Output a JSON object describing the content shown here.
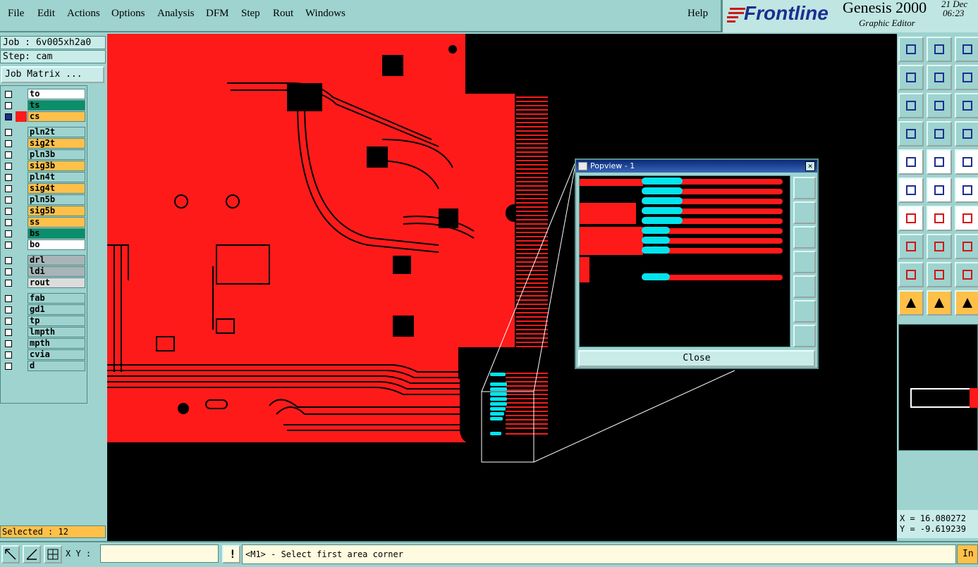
{
  "menu": {
    "items": [
      "File",
      "Edit",
      "Actions",
      "Options",
      "Analysis",
      "DFM",
      "Step",
      "Rout",
      "Windows"
    ],
    "help": "Help"
  },
  "brand": {
    "logo": "Frontline",
    "product": "Genesis 2000",
    "subtitle": "Graphic Editor",
    "date": "21 Dec",
    "time": "06:23"
  },
  "job": {
    "job_label": "Job : 6v005xh2a0",
    "step_label": "Step: cam",
    "matrix_button": "Job Matrix ..."
  },
  "layers": [
    {
      "name": "to",
      "color": "#ffffff"
    },
    {
      "name": "ts",
      "color": "#0a8f6a"
    },
    {
      "name": "cs",
      "color": "#ffc04a",
      "active": true
    },
    {
      "name": "pln2t",
      "color": "#9ed3cf"
    },
    {
      "name": "sig2t",
      "color": "#ffc04a"
    },
    {
      "name": "pln3b",
      "color": "#9ed3cf"
    },
    {
      "name": "sig3b",
      "color": "#ffc04a"
    },
    {
      "name": "pln4t",
      "color": "#9ed3cf"
    },
    {
      "name": "sig4t",
      "color": "#ffc04a"
    },
    {
      "name": "pln5b",
      "color": "#9ed3cf"
    },
    {
      "name": "sig5b",
      "color": "#ffc04a"
    },
    {
      "name": "ss",
      "color": "#ffc04a"
    },
    {
      "name": "bs",
      "color": "#0a8f6a"
    },
    {
      "name": "bo",
      "color": "#ffffff"
    },
    {
      "name": "drl",
      "color": "#a8b4b8"
    },
    {
      "name": "ldi",
      "color": "#a8b4b8"
    },
    {
      "name": "rout",
      "color": "#dcdcdc"
    },
    {
      "name": "fab",
      "color": "#9ed3cf"
    },
    {
      "name": "gd1",
      "color": "#9ed3cf"
    },
    {
      "name": "tp",
      "color": "#9ed3cf"
    },
    {
      "name": "lmpth",
      "color": "#9ed3cf"
    },
    {
      "name": "mpth",
      "color": "#9ed3cf"
    },
    {
      "name": "cvia",
      "color": "#9ed3cf"
    },
    {
      "name": "d",
      "color": "#9ed3cf"
    }
  ],
  "selected": "Selected : 12",
  "popview": {
    "title": "Popview - 1",
    "close_label": "Close"
  },
  "coords": {
    "x": "X =  16.080272",
    "y": "Y =  -9.619239"
  },
  "status": {
    "xy_label": "X Y :",
    "xy_value": "",
    "prompt": "<M1> - Select first area corner",
    "in_label": "In"
  },
  "colors": {
    "board": "#ff1a1a",
    "highlight": "#00e5ee",
    "panel": "#9ed3cf",
    "orange": "#ffc04a"
  },
  "icons": {
    "tools": [
      "zoom-home-icon",
      "zoom-window-icon",
      "home-icon",
      "pan-left-icon",
      "pan-right-icon",
      "undo-zoom-icon",
      "fit-screen-icon",
      "fit-profile-icon",
      "scale-1to2-icon",
      "measure-icon",
      "snap-icon",
      "layers-icon",
      "pad-icon",
      "line-icon",
      "ruler-icon",
      "node-icon",
      "intersect-icon",
      "arc-icon",
      "slope-icon",
      "diagonal-icon",
      "arc-ccw-icon",
      "pad-snap-icon",
      "center-icon",
      "grid-icon",
      "triangle-icon",
      "angle-icon",
      "letter-a-icon",
      "select-arrow-icon",
      "select-box-icon",
      "select-poly-icon"
    ]
  }
}
